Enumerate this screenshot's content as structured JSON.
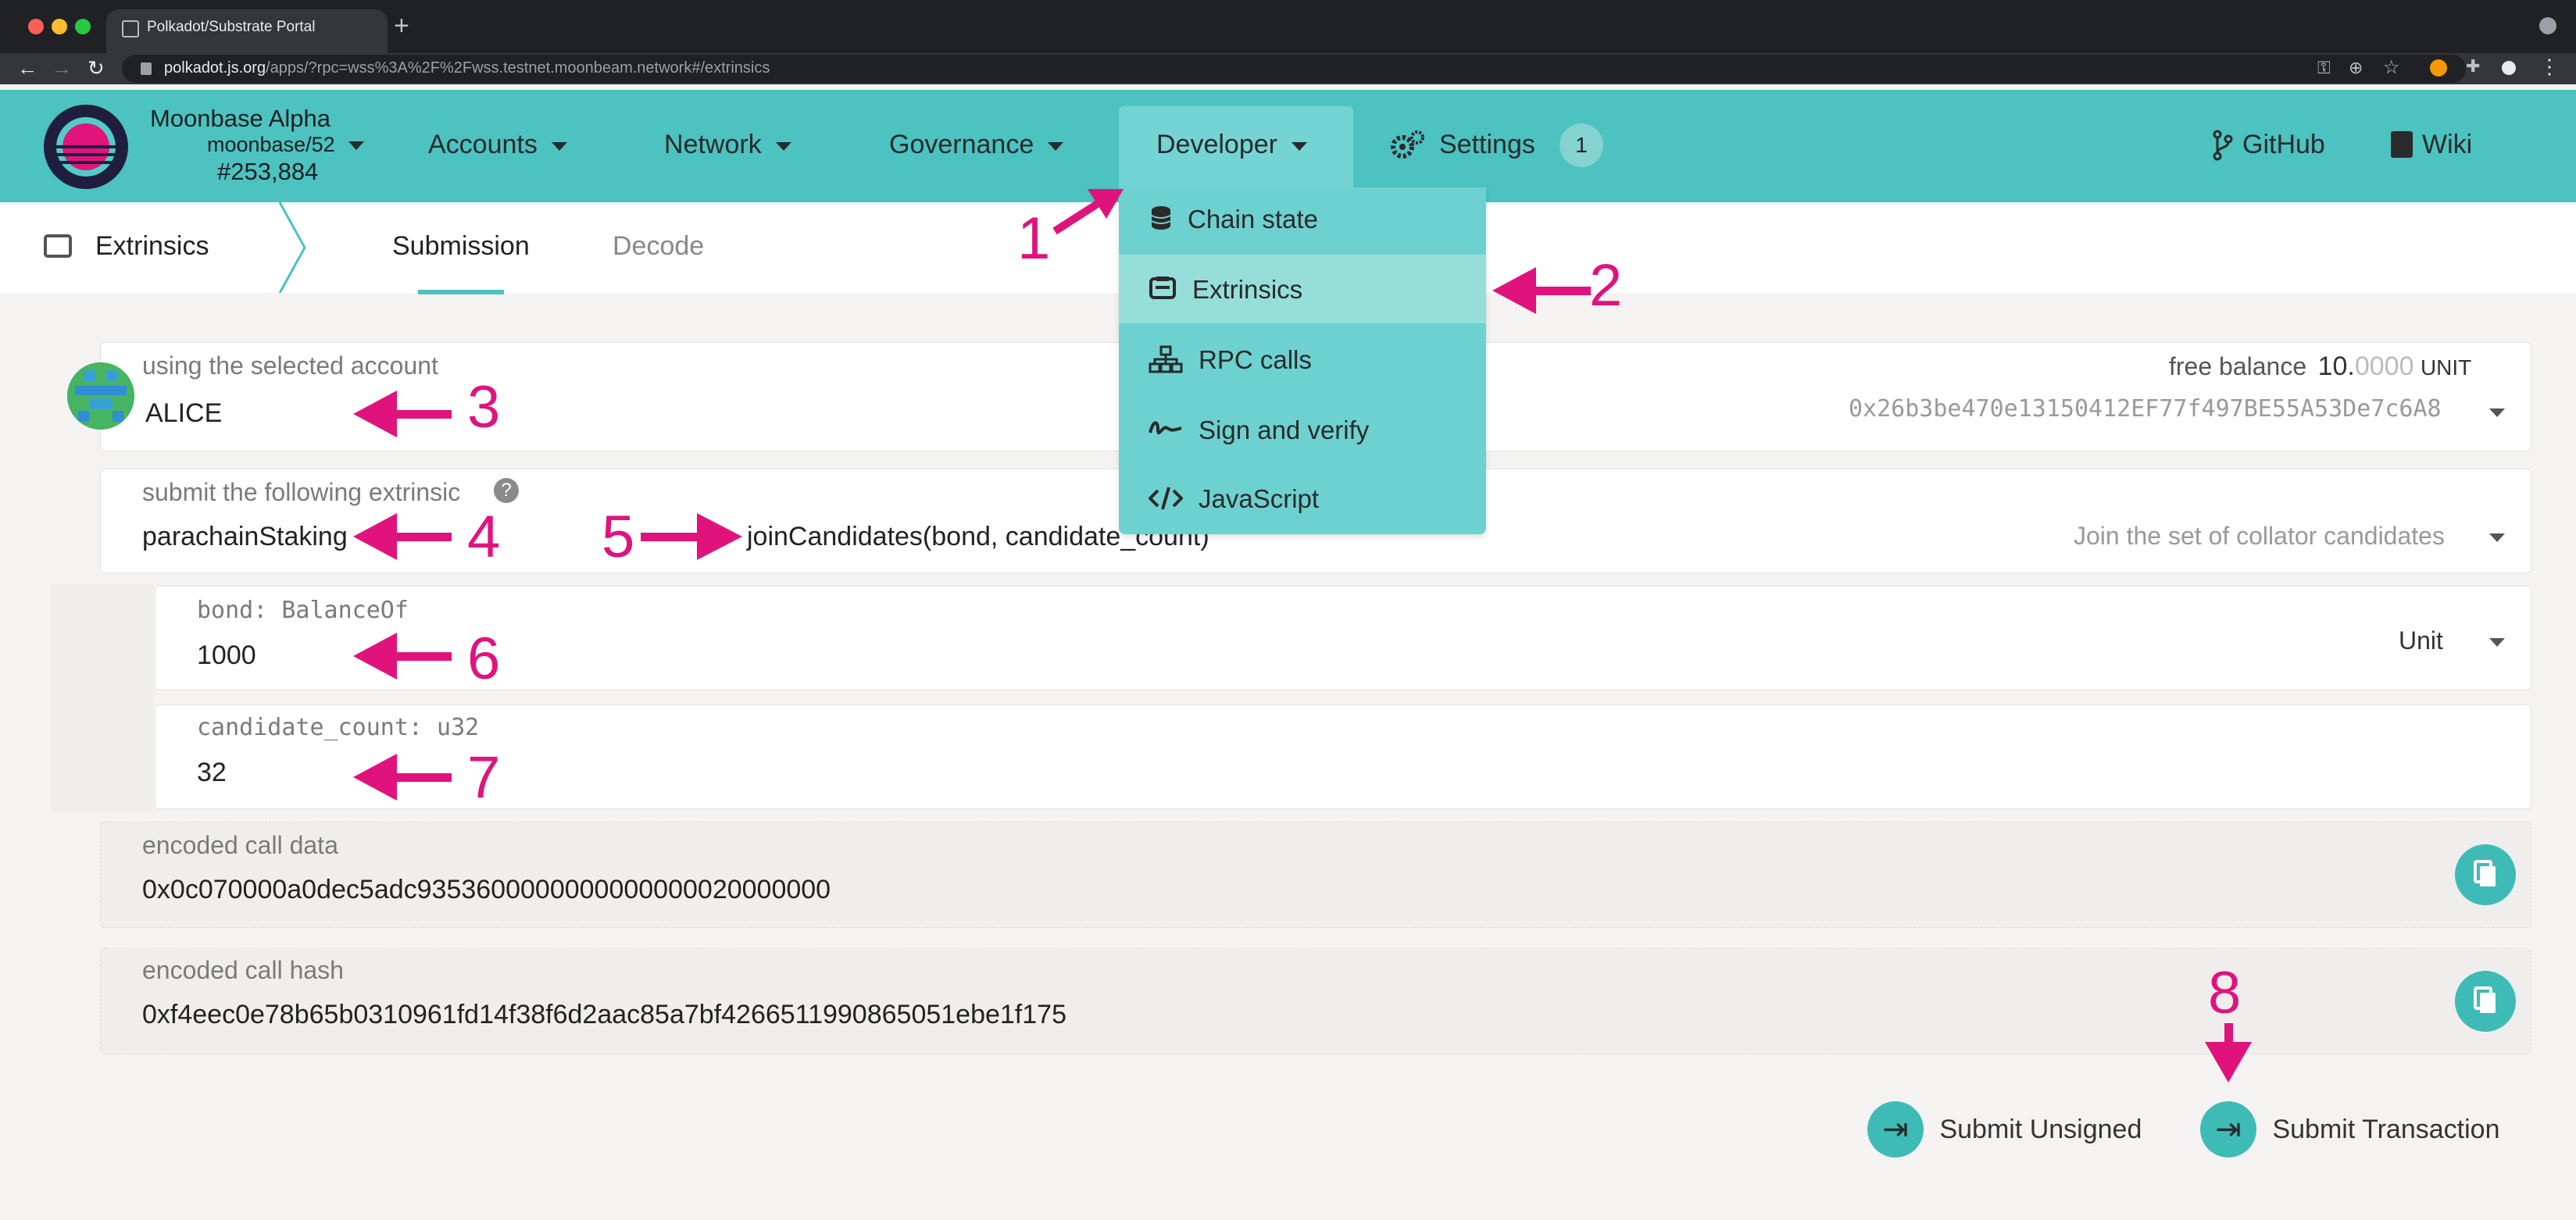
{
  "browser": {
    "tab_title": "Polkadot/Substrate Portal",
    "url_host": "polkadot.js.org",
    "url_path": "/apps/?rpc=wss%3A%2F%2Fwss.testnet.moonbeam.network#/extrinsics"
  },
  "header": {
    "network_name": "Moonbase Alpha",
    "chain_spec": "moonbase/52",
    "block_number": "#253,884",
    "nav": [
      "Accounts",
      "Network",
      "Governance",
      "Developer",
      "Settings"
    ],
    "settings_badge": "1",
    "links": [
      "GitHub",
      "Wiki"
    ],
    "accent": "#4cc2c1"
  },
  "dropdown": {
    "items": [
      {
        "label": "Chain state",
        "icon": "database-icon"
      },
      {
        "label": "Extrinsics",
        "icon": "extrinsics-icon"
      },
      {
        "label": "RPC calls",
        "icon": "network-icon"
      },
      {
        "label": "Sign and verify",
        "icon": "signature-icon"
      },
      {
        "label": "JavaScript",
        "icon": "code-icon"
      }
    ],
    "active": "Extrinsics"
  },
  "subnav": {
    "section": "Extrinsics",
    "tabs": [
      "Submission",
      "Decode"
    ],
    "active_tab": "Submission"
  },
  "account": {
    "label": "using the selected account",
    "name": "ALICE",
    "free_balance_label": "free balance",
    "balance_int": "10.",
    "balance_dec": "0000",
    "balance_unit": "UNIT",
    "address": "0x26b3be470e13150412EF77f497BE55A53De7c6A8"
  },
  "extrinsic": {
    "label": "submit the following extrinsic",
    "module": "parachainStaking",
    "method": "joinCandidates(bond, candidate_count)",
    "description": "Join the set of collator candidates"
  },
  "params": [
    {
      "label": "bond: BalanceOf",
      "value": "1000",
      "unit": "Unit"
    },
    {
      "label": "candidate_count: u32",
      "value": "32"
    }
  ],
  "encoded": {
    "call_data_label": "encoded call data",
    "call_data": "0x0c070000a0dec5adc9353600000000000000020000000",
    "call_hash_label": "encoded call hash",
    "call_hash": "0xf4eec0e78b65b0310961fd14f38f6d2aac85a7bf4266511990865051ebe1f175"
  },
  "actions": {
    "unsigned": "Submit Unsigned",
    "transaction": "Submit Transaction"
  },
  "annotations": [
    "1",
    "2",
    "3",
    "4",
    "5",
    "6",
    "7",
    "8"
  ],
  "annotation_color": "#e0137d"
}
